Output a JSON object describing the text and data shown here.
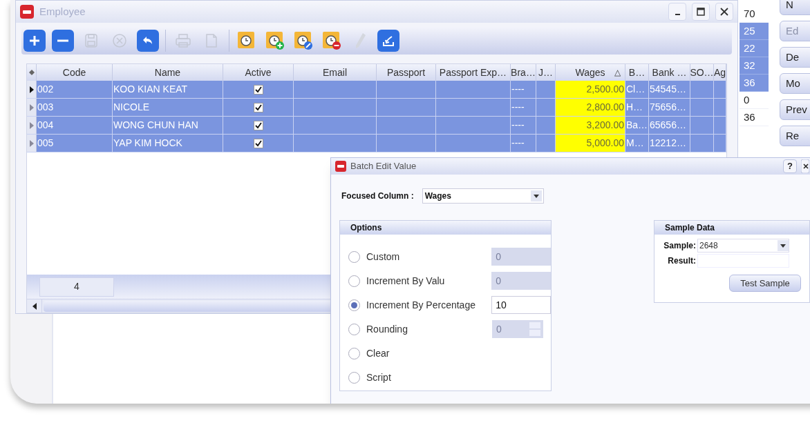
{
  "employee_window": {
    "title": "Employee",
    "toolbar": [
      {
        "kind": "add",
        "disabled": false
      },
      {
        "kind": "remove",
        "disabled": false
      },
      {
        "kind": "save",
        "disabled": true
      },
      {
        "kind": "cancel",
        "disabled": true
      },
      {
        "kind": "undo",
        "disabled": false
      },
      {
        "kind": "print",
        "disabled": true
      },
      {
        "kind": "export",
        "disabled": true
      },
      {
        "kind": "clock",
        "disabled": false
      },
      {
        "kind": "clock-add",
        "disabled": false
      },
      {
        "kind": "clock-edit",
        "disabled": false
      },
      {
        "kind": "clock-remove",
        "disabled": false
      },
      {
        "kind": "pencil",
        "disabled": true
      },
      {
        "kind": "import",
        "disabled": false
      }
    ],
    "grid": {
      "columns": [
        {
          "label": "Code",
          "kind": "text"
        },
        {
          "label": "Name",
          "kind": "text"
        },
        {
          "label": "Active",
          "kind": "check"
        },
        {
          "label": "Email",
          "kind": "text"
        },
        {
          "label": "Passport",
          "kind": "text"
        },
        {
          "label": "Passport Exp…",
          "kind": "text"
        },
        {
          "label": "Bra…",
          "kind": "text"
        },
        {
          "label": "J…",
          "kind": "text"
        },
        {
          "label": "Wages",
          "kind": "number",
          "focused": true,
          "sort_mark": "△"
        },
        {
          "label": "B…",
          "kind": "text"
        },
        {
          "label": "Bank …",
          "kind": "text"
        },
        {
          "label": "SO…",
          "kind": "text"
        },
        {
          "label": "Ag",
          "kind": "text"
        }
      ],
      "rows": [
        {
          "selected": true,
          "current": true,
          "code": "002",
          "name": "KOO KIAN KEAT",
          "active": true,
          "column_7": "----",
          "wages": "2,500.00",
          "column_10": "Cl…",
          "bank": "54545…"
        },
        {
          "selected": true,
          "current": false,
          "code": "003",
          "name": "NICOLE",
          "active": true,
          "column_7": "----",
          "wages": "2,800.00",
          "column_10": "H…",
          "bank": "75656…"
        },
        {
          "selected": true,
          "current": false,
          "code": "004",
          "name": "WONG CHUN HAN",
          "active": true,
          "column_7": "----",
          "wages": "3,200.00",
          "column_10": "Ba…",
          "bank": "65656…"
        },
        {
          "selected": true,
          "current": false,
          "code": "005",
          "name": "YAP KIM HOCK",
          "active": true,
          "column_7": "----",
          "wages": "5,000.00",
          "column_10": "M…",
          "bank": "12212…"
        }
      ],
      "footer_count": "4"
    }
  },
  "side_list": [
    {
      "text": "70",
      "selected": false
    },
    {
      "text": "25",
      "selected": true
    },
    {
      "text": "22",
      "selected": true
    },
    {
      "text": "32",
      "selected": true
    },
    {
      "text": "36",
      "selected": true
    },
    {
      "text": "0",
      "selected": false
    },
    {
      "text": "36",
      "selected": false
    }
  ],
  "side_buttons": [
    {
      "label": "N",
      "disabled": false
    },
    {
      "label": "Ed",
      "disabled": true
    },
    {
      "label": "De",
      "disabled": false
    },
    {
      "label": "Mo",
      "disabled": false
    },
    {
      "label": "Prev",
      "disabled": false
    },
    {
      "label": "Re",
      "disabled": false
    }
  ],
  "batch_dialog": {
    "title": "Batch Edit Value",
    "help": "?",
    "focused_column_label": "Focused Column :",
    "focused_column": "Wages",
    "options_title": "Options",
    "options": [
      {
        "label": "Custom",
        "selected": false,
        "input": {
          "value": "0",
          "disabled": true,
          "kind": "text"
        }
      },
      {
        "label": "Increment By Valu",
        "selected": false,
        "input": {
          "value": "0",
          "disabled": true,
          "kind": "text"
        }
      },
      {
        "label": "Increment By Percentage",
        "selected": true,
        "input": {
          "value": "10",
          "disabled": false,
          "kind": "text"
        }
      },
      {
        "label": "Rounding",
        "selected": false,
        "input": {
          "value": "0",
          "disabled": true,
          "kind": "spin"
        }
      },
      {
        "label": "Clear",
        "selected": false
      },
      {
        "label": "Script",
        "selected": false
      }
    ],
    "sample_title": "Sample Data",
    "sample_label": "Sample:",
    "sample_value": "2648",
    "result_label": "Result:",
    "test_button": "Test Sample"
  }
}
